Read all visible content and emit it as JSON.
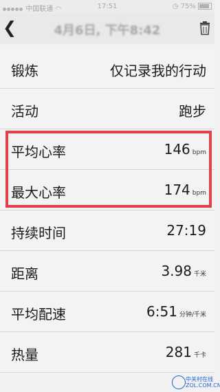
{
  "status": {
    "carrier": "中国联通",
    "time": "17:51",
    "battery": "75%"
  },
  "nav": {
    "back_icon": "chevron-left-icon",
    "title": "4月6日, 下午8:42",
    "trash_icon": "trash-icon"
  },
  "rows": [
    {
      "label": "锻炼",
      "value": "仅记录我的行动",
      "unit": ""
    },
    {
      "label": "活动",
      "value": "跑步",
      "unit": ""
    },
    {
      "label": "平均心率",
      "value": "146",
      "unit": "bpm"
    },
    {
      "label": "最大心率",
      "value": "174",
      "unit": "bpm"
    },
    {
      "label": "持续时间",
      "value": "27:19",
      "unit": ""
    },
    {
      "label": "距离",
      "value": "3.98",
      "unit": "千米"
    },
    {
      "label": "平均配速",
      "value": "6:51",
      "unit": "分钟/千米"
    },
    {
      "label": "热量",
      "value": "281",
      "unit": "千卡"
    }
  ],
  "highlight_color": "#e2404b",
  "watermark": {
    "line1": "中关村在线",
    "line2": "ZOL.COM.CN"
  }
}
